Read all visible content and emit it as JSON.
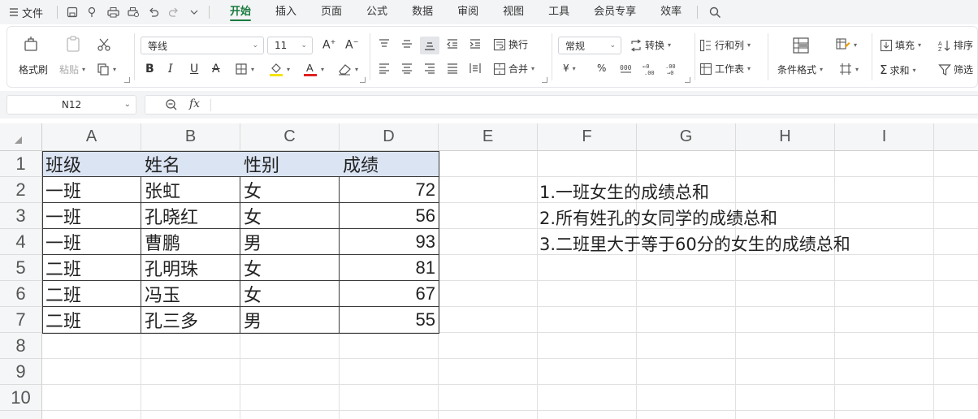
{
  "menubar": {
    "file_label": "文件",
    "tabs": [
      "开始",
      "插入",
      "页面",
      "公式",
      "数据",
      "审阅",
      "视图",
      "工具",
      "会员专享",
      "效率"
    ],
    "active_tab": "开始"
  },
  "ribbon": {
    "format_painter": "格式刷",
    "paste": "粘贴",
    "font_name": "等线",
    "font_size": "11",
    "wrap_text": "换行",
    "merge": "合并",
    "number_format": "常规",
    "convert": "转换",
    "row_col": "行和列",
    "worksheet": "工作表",
    "conditional_format": "条件格式",
    "fill": "填充",
    "sort": "排序",
    "sum": "求和",
    "filter": "筛选",
    "currency_symbol": "¥",
    "percent_symbol": "%"
  },
  "formula_bar": {
    "cell_ref": "N12",
    "fx_label": "fx",
    "formula_value": ""
  },
  "sheet": {
    "columns": [
      "A",
      "B",
      "C",
      "D",
      "E",
      "F",
      "G",
      "H",
      "I"
    ],
    "rows": [
      "1",
      "2",
      "3",
      "4",
      "5",
      "6",
      "7",
      "8",
      "9",
      "10"
    ],
    "table_header": {
      "A": "班级",
      "B": "姓名",
      "C": "性别",
      "D": "成绩"
    },
    "table_rows": [
      {
        "class": "一班",
        "name": "张虹",
        "gender": "女",
        "score": "72"
      },
      {
        "class": "一班",
        "name": "孔晓红",
        "gender": "女",
        "score": "56"
      },
      {
        "class": "一班",
        "name": "曹鹏",
        "gender": "男",
        "score": "93"
      },
      {
        "class": "二班",
        "name": "孔明珠",
        "gender": "女",
        "score": "81"
      },
      {
        "class": "二班",
        "name": "冯玉",
        "gender": "女",
        "score": "67"
      },
      {
        "class": "二班",
        "name": "孔三多",
        "gender": "男",
        "score": "55"
      }
    ],
    "notes": [
      "1.一班女生的成绩总和",
      "2.所有姓孔的女同学的成绩总和",
      "3.二班里大于等于60分的女生的成绩总和"
    ]
  },
  "colors": {
    "accent": "#1a7a3e",
    "header_fill": "#dbe4f3",
    "font_color_swatch": "#e02020",
    "fill_color_swatch": "#f5e400"
  }
}
